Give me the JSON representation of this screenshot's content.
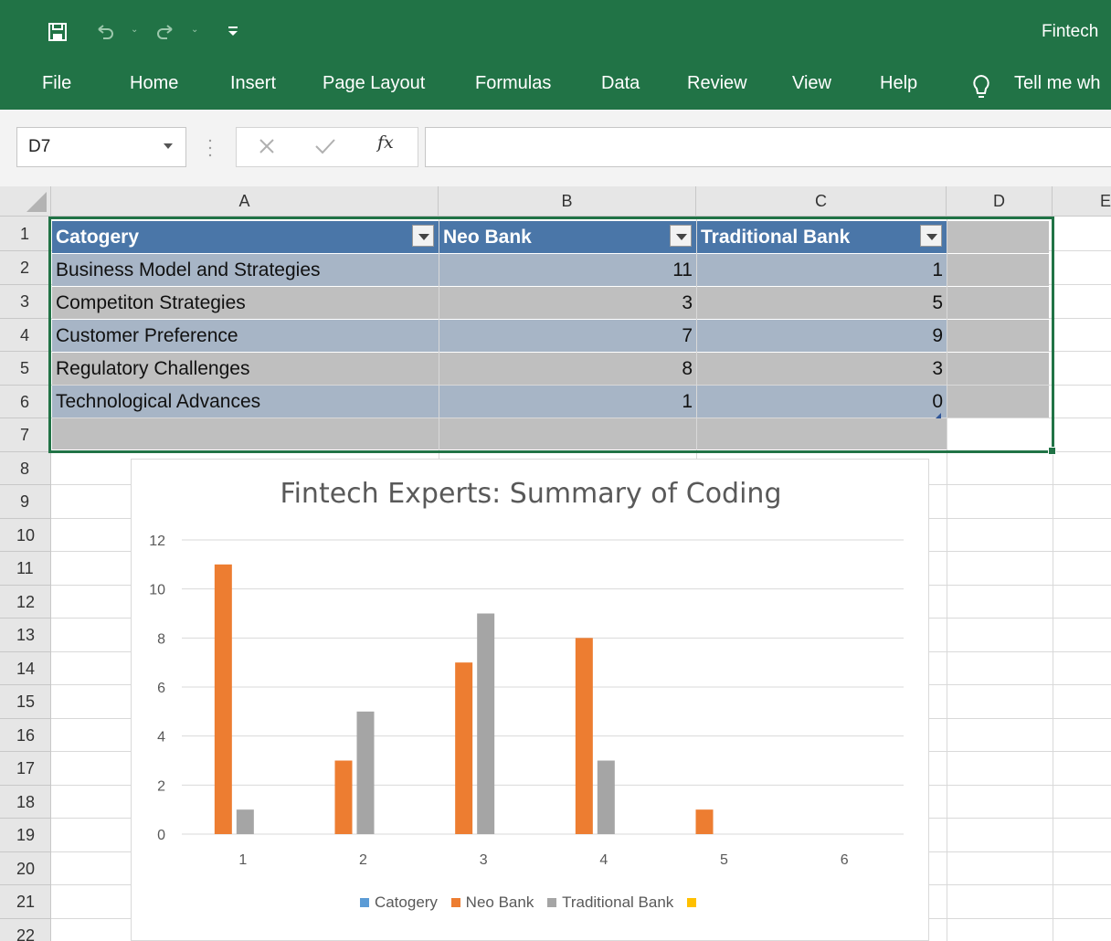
{
  "titlebar": {
    "doc_title": "Fintech"
  },
  "ribbon": {
    "tabs": [
      "File",
      "Home",
      "Insert",
      "Page Layout",
      "Formulas",
      "Data",
      "Review",
      "View",
      "Help"
    ],
    "tell_me": "Tell me wh"
  },
  "formula_bar": {
    "name_box": "D7",
    "fx_label": "fx",
    "formula": ""
  },
  "sheet": {
    "columns": [
      "A",
      "B",
      "C",
      "D",
      "E"
    ],
    "rows": [
      "1",
      "2",
      "3",
      "4",
      "5",
      "6",
      "7",
      "8",
      "9",
      "10",
      "11",
      "12",
      "13",
      "14",
      "15",
      "16",
      "17",
      "18",
      "19",
      "20",
      "21",
      "22"
    ],
    "table": {
      "headers": [
        "Catogery",
        "Neo Bank",
        "Traditional Bank"
      ],
      "rows": [
        [
          "Business Model and Strategies",
          "11",
          "1"
        ],
        [
          "Competiton Strategies",
          "3",
          "5"
        ],
        [
          "Customer Preference",
          "7",
          "9"
        ],
        [
          "Regulatory Challenges",
          "8",
          "3"
        ],
        [
          "Technological Advances",
          "1",
          "0"
        ]
      ]
    }
  },
  "colors": {
    "excel_green": "#217346",
    "neo_bank": "#ed7d31",
    "traditional_bank": "#a5a5a5",
    "catogery": "#5b9bd5",
    "series4": "#ffc000"
  },
  "chart_data": {
    "type": "bar",
    "title": "Fintech Experts: Summary of Coding",
    "categories": [
      "1",
      "2",
      "3",
      "4",
      "5",
      "6"
    ],
    "series": [
      {
        "name": "Catogery",
        "values": [
          null,
          null,
          null,
          null,
          null,
          null
        ]
      },
      {
        "name": "Neo Bank",
        "values": [
          11,
          3,
          7,
          8,
          1,
          null
        ]
      },
      {
        "name": "Traditional Bank",
        "values": [
          1,
          5,
          9,
          3,
          0,
          null
        ]
      },
      {
        "name": "",
        "values": [
          null,
          null,
          null,
          null,
          null,
          null
        ]
      }
    ],
    "yticks": [
      "0",
      "2",
      "4",
      "6",
      "8",
      "10",
      "12"
    ],
    "ylim": [
      0,
      12
    ],
    "grid": true,
    "legend": "bottom"
  }
}
